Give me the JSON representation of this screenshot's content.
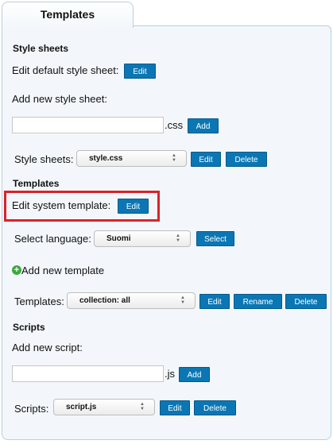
{
  "tab": {
    "label": "Templates"
  },
  "style_sheets": {
    "heading": "Style sheets",
    "edit_default_label": "Edit default style sheet:",
    "edit_button": "Edit",
    "add_new_label": "Add new style sheet:",
    "new_input_value": "",
    "extension": ".css",
    "add_button": "Add",
    "select_label": "Style sheets:",
    "selected": "style.css",
    "select_edit_button": "Edit",
    "delete_button": "Delete"
  },
  "templates": {
    "heading": "Templates",
    "edit_system_label": "Edit system template:",
    "edit_system_button": "Edit",
    "language_label": "Select language:",
    "language_selected": "Suomi",
    "language_select_button": "Select",
    "add_new_template": "Add new template",
    "select_label": "Templates:",
    "selected": "collection: all",
    "edit_button": "Edit",
    "rename_button": "Rename",
    "delete_button": "Delete"
  },
  "scripts": {
    "heading": "Scripts",
    "add_new_label": "Add new script:",
    "new_input_value": "",
    "extension": ".js",
    "add_button": "Add",
    "select_label": "Scripts:",
    "selected": "script.js",
    "edit_button": "Edit",
    "delete_button": "Delete"
  },
  "icons": {
    "add_template": "plus-circle-icon",
    "select_arrows": "chevron-up-down-icon"
  },
  "colors": {
    "button_bg": "#0a77b4",
    "panel_bg": "#f3f7fb",
    "highlight": "#d9232a",
    "plus_icon": "#3fa83f"
  }
}
